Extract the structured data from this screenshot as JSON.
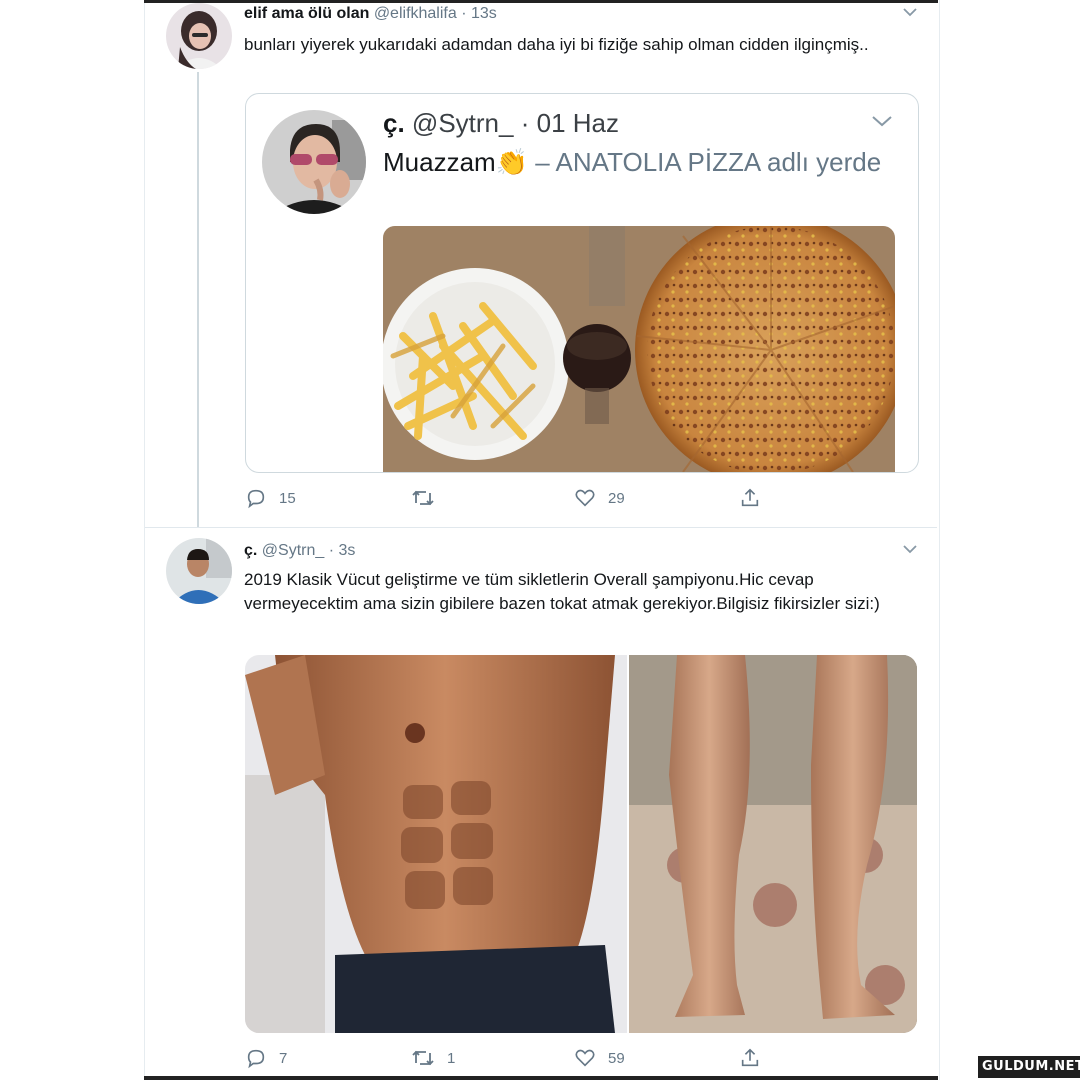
{
  "tweet1": {
    "name": "elif ama ölü olan",
    "handle": "@elifkhalifa",
    "separator": "·",
    "time": "13s",
    "text": "bunları yiyerek yukarıdaki adamdan daha iyi bi fiziğe sahip olman cidden ilginçmiş..",
    "quote": {
      "name": "ç.",
      "handle": "@Sytrn_",
      "separator": "·",
      "time": "01 Haz",
      "text_main": "Muazzam",
      "text_emoji": "👏",
      "text_place": " – ANATOLIA PİZZA adlı yerde"
    },
    "actions": {
      "replies": "15",
      "retweets": "",
      "likes": "29"
    }
  },
  "tweet2": {
    "name": "ç.",
    "handle": "@Sytrn_",
    "separator": "·",
    "time": "3s",
    "text": "2019 Klasik Vücut geliştirme ve tüm sikletlerin Overall şampiyonu.Hic cevap vermeyecektim ama sizin gibilere bazen tokat atmak gerekiyor.Bilgisiz fikirsizler sizi:)",
    "actions": {
      "replies": "7",
      "retweets": "1",
      "likes": "59"
    }
  },
  "watermark": "GULDUM.NET",
  "icons": [
    "reply-icon",
    "retweet-icon",
    "like-icon",
    "share-icon",
    "chevron-down-icon",
    "clap-emoji"
  ],
  "colors": {
    "text": "#14171a",
    "secondary": "#657786",
    "border": "#cfd9de"
  }
}
